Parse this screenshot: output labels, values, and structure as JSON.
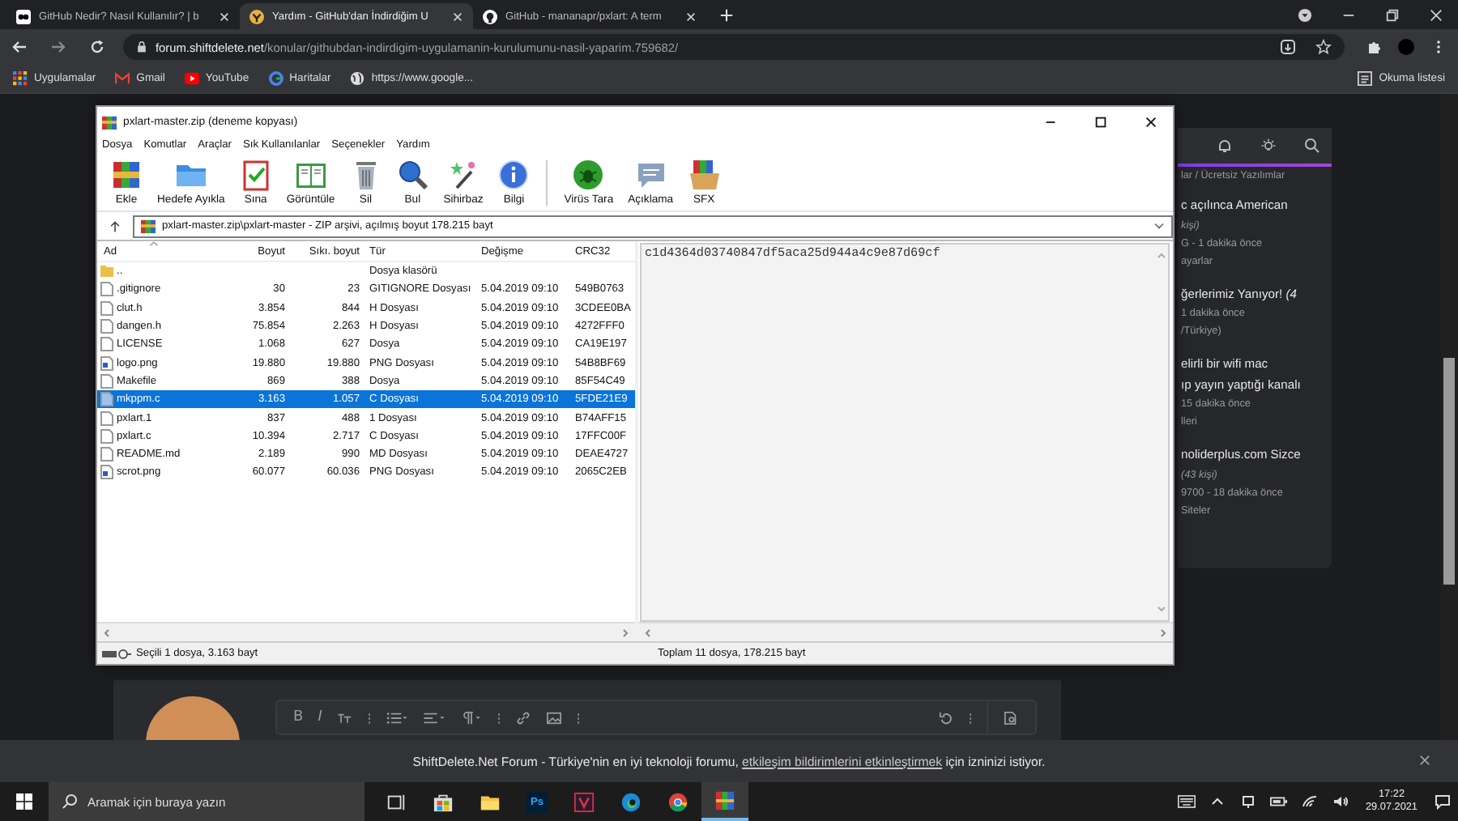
{
  "browser": {
    "tabs": [
      {
        "title": "GitHub Nedir? Nasıl Kullanılır? | b",
        "kind": "sdn",
        "selected": false
      },
      {
        "title": "Yardım - GitHub'dan İndirdiğim U",
        "kind": "forum",
        "selected": true
      },
      {
        "title": "GitHub - mananapr/pxlart: A term",
        "kind": "github",
        "selected": false
      }
    ],
    "address": {
      "host": "forum.shiftdelete.net",
      "path": "/konular/githubdan-indirdigim-uygulamanin-kurulumunu-nasil-yaparim.759682/"
    },
    "bookmarks": [
      {
        "label": "Uygulamalar",
        "kind": "apps"
      },
      {
        "label": "Gmail",
        "kind": "gmail"
      },
      {
        "label": "YouTube",
        "kind": "youtube"
      },
      {
        "label": "Haritalar",
        "kind": "google"
      },
      {
        "label": "https://www.google...",
        "kind": "globe"
      }
    ],
    "reading_list": "Okuma listesi"
  },
  "forum_panel": {
    "category": "lar / Ücretsiz Yazılımlar",
    "entries": [
      {
        "titles": [
          "c açılınca American"
        ],
        "meta": [
          "*kişi)*",
          "G - 1 dakika önce",
          "ayarlar"
        ]
      },
      {
        "titles": [
          "ğerlerimiz Yanıyor! *(4*"
        ],
        "meta": [
          "1 dakika önce",
          "/Türkiye)"
        ]
      },
      {
        "titles": [
          "elirli bir wifi mac",
          "ıp yayın yaptığı kanalı"
        ],
        "meta": [
          "15 dakika önce",
          "lleri"
        ]
      },
      {
        "titles": [
          "noliderplus.com Sizce"
        ],
        "meta": [
          "*(43 kişi)*",
          "9700 - 18 dakika önce",
          "Siteler"
        ]
      }
    ]
  },
  "winrar": {
    "title": "pxlart-master.zip (deneme kopyası)",
    "menu": [
      "Dosya",
      "Komutlar",
      "Araçlar",
      "Sık Kullanılanlar",
      "Seçenekler",
      "Yardım"
    ],
    "toolbar_groups": [
      [
        {
          "label": "Ekle",
          "kind": "add"
        },
        {
          "label": "Hedefe Ayıkla",
          "kind": "extract"
        },
        {
          "label": "Sına",
          "kind": "test"
        },
        {
          "label": "Görüntüle",
          "kind": "view"
        },
        {
          "label": "Sil",
          "kind": "delete"
        },
        {
          "label": "Bul",
          "kind": "find"
        },
        {
          "label": "Sihirbaz",
          "kind": "wizard"
        },
        {
          "label": "Bilgi",
          "kind": "info"
        }
      ],
      [
        {
          "label": "Virüs Tara",
          "kind": "virus"
        },
        {
          "label": "Açıklama",
          "kind": "comment"
        },
        {
          "label": "SFX",
          "kind": "sfx"
        }
      ]
    ],
    "path": "pxlart-master.zip\\pxlart-master - ZIP arşivi, açılmış boyut 178.215 bayt",
    "columns": [
      "Ad",
      "Boyut",
      "Sıkı. boyut",
      "Tür",
      "Değişme",
      "CRC32"
    ],
    "rows": [
      {
        "name": "..",
        "type": "Dosya klasörü",
        "kind": "folder",
        "selected": false
      },
      {
        "name": ".gitignore",
        "size": "30",
        "packed": "23",
        "type": "GITIGNORE Dosyası",
        "modified": "5.04.2019 09:10",
        "crc": "549B0763",
        "kind": "file",
        "selected": false
      },
      {
        "name": "clut.h",
        "size": "3.854",
        "packed": "844",
        "type": "H Dosyası",
        "modified": "5.04.2019 09:10",
        "crc": "3CDEE0BA",
        "kind": "file",
        "selected": false
      },
      {
        "name": "dangen.h",
        "size": "75.854",
        "packed": "2.263",
        "type": "H Dosyası",
        "modified": "5.04.2019 09:10",
        "crc": "4272FFF0",
        "kind": "file",
        "selected": false
      },
      {
        "name": "LICENSE",
        "size": "1.068",
        "packed": "627",
        "type": "Dosya",
        "modified": "5.04.2019 09:10",
        "crc": "CA19E197",
        "kind": "file",
        "selected": false
      },
      {
        "name": "logo.png",
        "size": "19.880",
        "packed": "19.880",
        "type": "PNG Dosyası",
        "modified": "5.04.2019 09:10",
        "crc": "54B8BF69",
        "kind": "image",
        "selected": false
      },
      {
        "name": "Makefile",
        "size": "869",
        "packed": "388",
        "type": "Dosya",
        "modified": "5.04.2019 09:10",
        "crc": "85F54C49",
        "kind": "file",
        "selected": false
      },
      {
        "name": "mkppm.c",
        "size": "3.163",
        "packed": "1.057",
        "type": "C Dosyası",
        "modified": "5.04.2019 09:10",
        "crc": "5FDE21E9",
        "kind": "file",
        "selected": true
      },
      {
        "name": "pxlart.1",
        "size": "837",
        "packed": "488",
        "type": "1 Dosyası",
        "modified": "5.04.2019 09:10",
        "crc": "B74AFF15",
        "kind": "file",
        "selected": false
      },
      {
        "name": "pxlart.c",
        "size": "10.394",
        "packed": "2.717",
        "type": "C Dosyası",
        "modified": "5.04.2019 09:10",
        "crc": "17FFC00F",
        "kind": "file",
        "selected": false
      },
      {
        "name": "README.md",
        "size": "2.189",
        "packed": "990",
        "type": "MD Dosyası",
        "modified": "5.04.2019 09:10",
        "crc": "DEAE4727",
        "kind": "file",
        "selected": false
      },
      {
        "name": "scrot.png",
        "size": "60.077",
        "packed": "60.036",
        "type": "PNG Dosyası",
        "modified": "5.04.2019 09:10",
        "crc": "2065C2EB",
        "kind": "image",
        "selected": false
      }
    ],
    "comment": "c1d4364d03740847df5aca25d944a4c9e87d69cf",
    "status_left": "Seçili 1 dosya, 3.163 bayt",
    "status_right": "Toplam 11 dosya, 178.215 bayt"
  },
  "editor": {
    "bold_glyph": "B",
    "italic_glyph": "I"
  },
  "notification": {
    "before": "ShiftDelete.Net Forum - Türkiye'nin en iyi teknoloji forumu, ",
    "link": "etkileşim bildirimlerini etkinleştirmek",
    "after": " için izninizi istiyor."
  },
  "taskbar": {
    "search_placeholder": "Aramak için buraya yazın",
    "apps": [
      {
        "kind": "task-view",
        "selected": false
      },
      {
        "kind": "store",
        "selected": false
      },
      {
        "kind": "explorer",
        "selected": false
      },
      {
        "kind": "photoshop",
        "label": "Ps",
        "selected": false
      },
      {
        "kind": "media",
        "selected": false
      },
      {
        "kind": "edge",
        "selected": false
      },
      {
        "kind": "chrome",
        "selected": false
      },
      {
        "kind": "archiver",
        "selected": true
      }
    ],
    "time": "17:22",
    "date": "29.07.2021"
  }
}
